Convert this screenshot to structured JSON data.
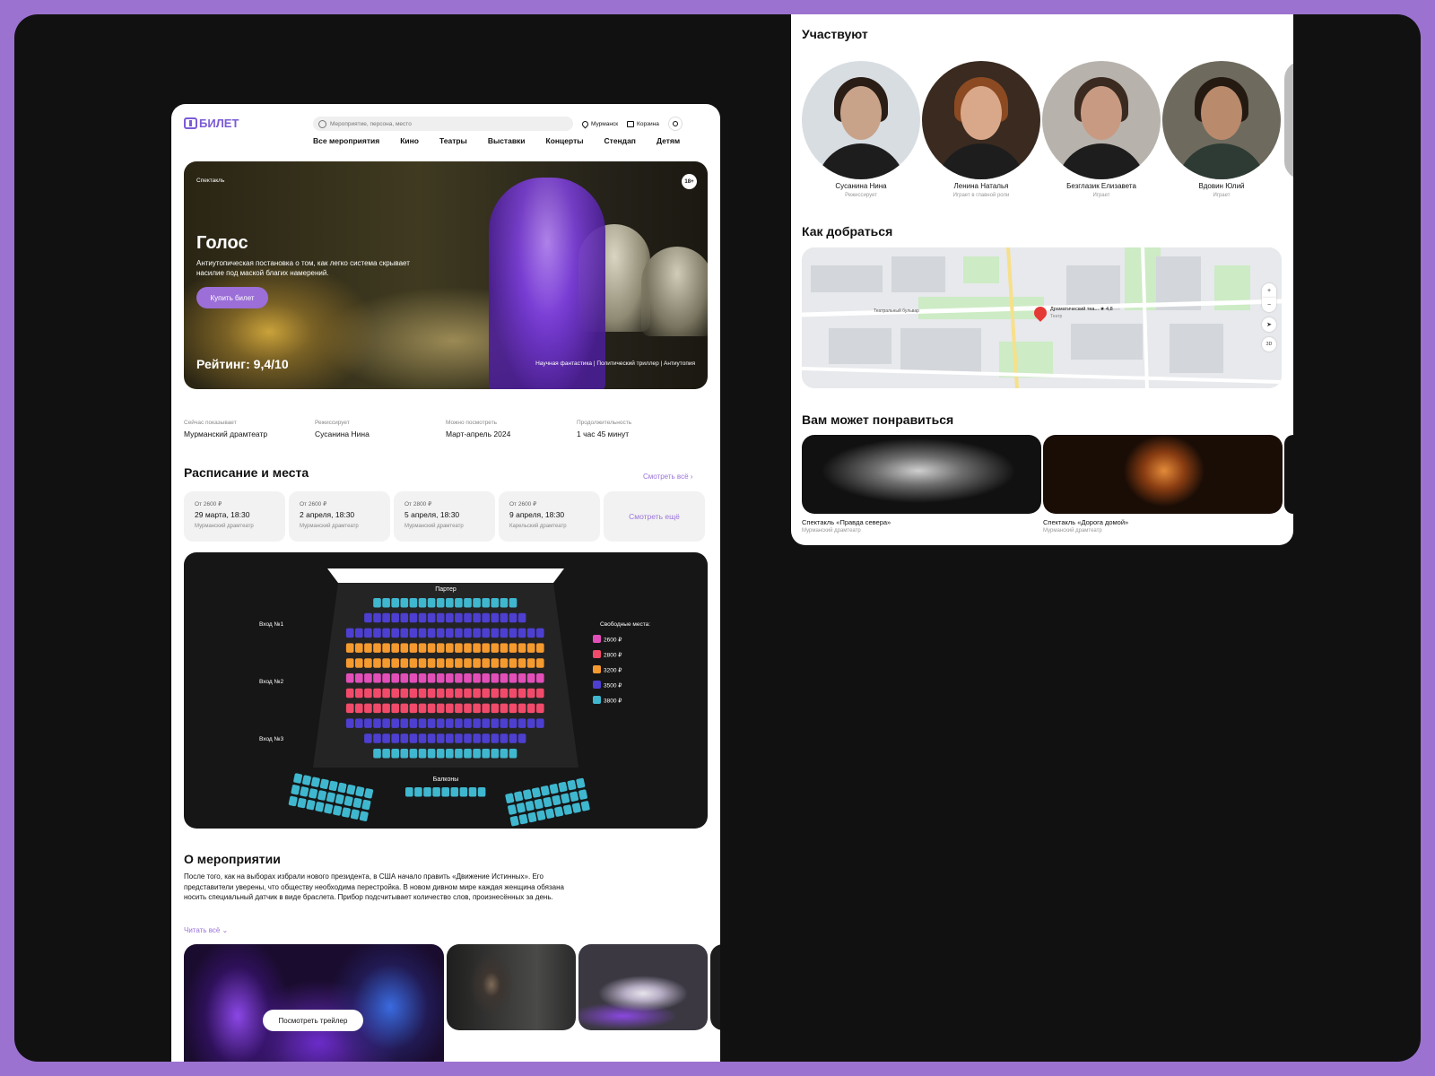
{
  "app": {
    "logo_text": "БИЛЕТ",
    "search_placeholder": "Мероприятие, персона, место",
    "city": "Мурманск",
    "cart": "Корзина"
  },
  "nav": [
    "Все мероприятия",
    "Кино",
    "Театры",
    "Выставки",
    "Концерты",
    "Стендап",
    "Детям"
  ],
  "hero": {
    "tag": "Спектакль",
    "age": "18+",
    "title": "Голос",
    "description": "Антиутопическая постановка о том, как легко система скрывает насилие под маской благих намерений.",
    "buy_label": "Купить билет",
    "rating": "Рейтинг: 9,4/10",
    "genres": "Научная фантастика | Политический триллер | Антиутопия"
  },
  "facts": [
    {
      "label": "Сейчас показывает",
      "value": "Мурманский драмтеатр"
    },
    {
      "label": "Режиссирует",
      "value": "Сусанина Нина"
    },
    {
      "label": "Можно посмотреть",
      "value": "Март-апрель 2024"
    },
    {
      "label": "Продолжительность",
      "value": "1 час 45 минут"
    }
  ],
  "schedule": {
    "title": "Расписание и места",
    "see_all": "Смотреть всё",
    "cards": [
      {
        "price": "От 2600 ₽",
        "date": "29 марта, 18:30",
        "venue": "Мурманский драмтеатр"
      },
      {
        "price": "От 2600 ₽",
        "date": "2 апреля, 18:30",
        "venue": "Мурманский драмтеатр"
      },
      {
        "price": "От 2800 ₽",
        "date": "5 апреля, 18:30",
        "venue": "Мурманский драмтеатр"
      },
      {
        "price": "От 2600 ₽",
        "date": "9 апреля, 18:30",
        "venue": "Карельский драмтеатр"
      }
    ],
    "more": "Смотреть ещё"
  },
  "hall": {
    "parter": "Партер",
    "balcony": "Балконы",
    "entrances": [
      "Вход №1",
      "Вход №2",
      "Вход №3"
    ],
    "legend_title": "Свободные места:",
    "legend": [
      {
        "price": "2600 ₽",
        "color": "#e24fb8"
      },
      {
        "price": "2800 ₽",
        "color": "#f24a6a"
      },
      {
        "price": "3200 ₽",
        "color": "#f59a2f"
      },
      {
        "price": "3500 ₽",
        "color": "#4d3fd0"
      },
      {
        "price": "3800 ₽",
        "color": "#3fb7cf"
      }
    ]
  },
  "about": {
    "title": "О мероприятии",
    "text": "После того, как на выборах избрали нового президента, в США начало править «Движение Истинных». Его представители уверены, что обществу необходима перестройка. В новом дивном мире каждая женщина обязана носить специальный датчик в виде браслета. Прибор подсчитывает количество слов, произнесённых за день.",
    "read_all": "Читать всё",
    "trailer": "Посмотреть трейлер"
  },
  "cast": {
    "title": "Участвуют",
    "people": [
      {
        "name": "Сусанина Нина",
        "role": "Режиссирует"
      },
      {
        "name": "Ленина Наталья",
        "role": "Играет в главной роли"
      },
      {
        "name": "Безглазик Елизавета",
        "role": "Играет"
      },
      {
        "name": "Вдовин Юлий",
        "role": "Играет"
      }
    ]
  },
  "map": {
    "title": "Как добраться",
    "place": "Драматический теа... ★ 4,8",
    "place_type": "Театр",
    "street": "Театральный бульвар",
    "zoom_in": "+",
    "zoom_out": "−",
    "mode_3d": "3D"
  },
  "suggest": {
    "title": "Вам может понравиться",
    "items": [
      {
        "name": "Спектакль «Правда севера»",
        "venue": "Мурманский драмтеатр"
      },
      {
        "name": "Спектакль «Дорога домой»",
        "venue": "Мурманский драмтеатр"
      }
    ]
  },
  "colors": {
    "accent": "#9b6ed8",
    "dark_card": "#161616",
    "frame": "#9b72cf"
  }
}
